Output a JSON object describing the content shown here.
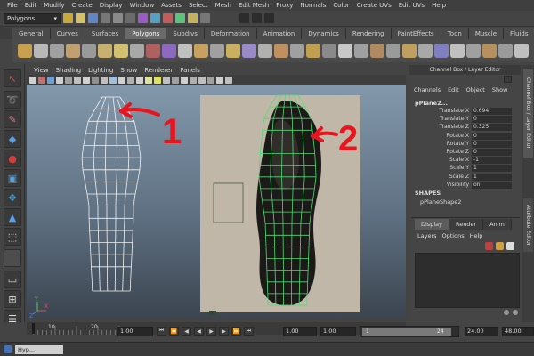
{
  "menubar": [
    "File",
    "Edit",
    "Modify",
    "Create",
    "Display",
    "Window",
    "Assets",
    "Select",
    "Mesh",
    "Edit Mesh",
    "Proxy",
    "Normals",
    "Color",
    "Create UVs",
    "Edit UVs",
    "Help"
  ],
  "status": {
    "mode": "Polygons"
  },
  "shelf_tabs": [
    "General",
    "Curves",
    "Surfaces",
    "Polygons",
    "Subdivs",
    "Deformation",
    "Animation",
    "Dynamics",
    "Rendering",
    "PaintEffects",
    "Toon",
    "Muscle",
    "Fluids",
    "Fur"
  ],
  "shelf_active": "Polygons",
  "viewport_menu": [
    "View",
    "Shading",
    "Lighting",
    "Show",
    "Renderer",
    "Panels"
  ],
  "annotations": [
    {
      "label": "1",
      "color": "#e8141e"
    },
    {
      "label": "2",
      "color": "#e8141e"
    }
  ],
  "axis": {
    "x": "X",
    "y": "Y",
    "z": "Z"
  },
  "channel_box": {
    "title": "Channel Box / Layer Editor",
    "menu": [
      "Channels",
      "Edit",
      "Object",
      "Show"
    ],
    "object": "pPlane2...",
    "attributes": [
      {
        "name": "Translate X",
        "value": "0.694"
      },
      {
        "name": "Translate Y",
        "value": "0"
      },
      {
        "name": "Translate Z",
        "value": "0.325"
      },
      {
        "name": "Rotate X",
        "value": "0"
      },
      {
        "name": "Rotate Y",
        "value": "0"
      },
      {
        "name": "Rotate Z",
        "value": "0"
      },
      {
        "name": "Scale X",
        "value": "-1"
      },
      {
        "name": "Scale Y",
        "value": "1"
      },
      {
        "name": "Scale Z",
        "value": "1"
      },
      {
        "name": "Visibility",
        "value": "on"
      }
    ],
    "shapes_header": "SHAPES",
    "shape": "pPlaneShape2"
  },
  "layer_editor": {
    "tabs": [
      "Display",
      "Render",
      "Anim"
    ],
    "active_tab": "Display",
    "menu": [
      "Layers",
      "Options",
      "Help"
    ]
  },
  "side_tabs": [
    "Channel Box / Layer Editor",
    "Attribute Editor"
  ],
  "timeline": {
    "ticks": [
      "10",
      "20"
    ],
    "start": "1.00",
    "current": "1.00",
    "range_start": "1.00",
    "range_end_field": "1.00",
    "range_slider_start": "1",
    "range_slider_end": "24",
    "end": "24.00",
    "max": "48.00",
    "cmd_label": "Hyp..."
  }
}
